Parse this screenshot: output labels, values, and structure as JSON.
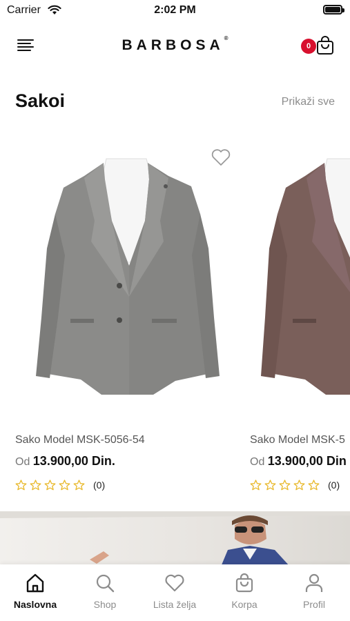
{
  "status_bar": {
    "carrier": "Carrier",
    "time": "2:02 PM"
  },
  "header": {
    "brand": "BARBOSA",
    "brand_mark": "®",
    "cart_count": "0"
  },
  "section": {
    "title": "Sakoi",
    "see_all": "Prikaži sve"
  },
  "products": [
    {
      "name": "Sako Model MSK-5056-54",
      "price_prefix": "Od",
      "price": "13.900,00 Din.",
      "reviews": "(0)",
      "rating": 0,
      "color": "#8a8a88"
    },
    {
      "name": "Sako Model MSK-5",
      "price_prefix": "Od",
      "price": "13.900,00 Din",
      "reviews": "(0)",
      "rating": 0,
      "color": "#7a5f5a"
    }
  ],
  "tabs": [
    {
      "label": "Naslovna",
      "icon": "home-icon",
      "active": true
    },
    {
      "label": "Shop",
      "icon": "search-icon",
      "active": false
    },
    {
      "label": "Lista želja",
      "icon": "heart-icon",
      "active": false
    },
    {
      "label": "Korpa",
      "icon": "bag-icon",
      "active": false
    },
    {
      "label": "Profil",
      "icon": "user-icon",
      "active": false
    }
  ],
  "colors": {
    "accent": "#d8102e",
    "star": "#e8b82a",
    "inactive": "#8c8c8c"
  }
}
